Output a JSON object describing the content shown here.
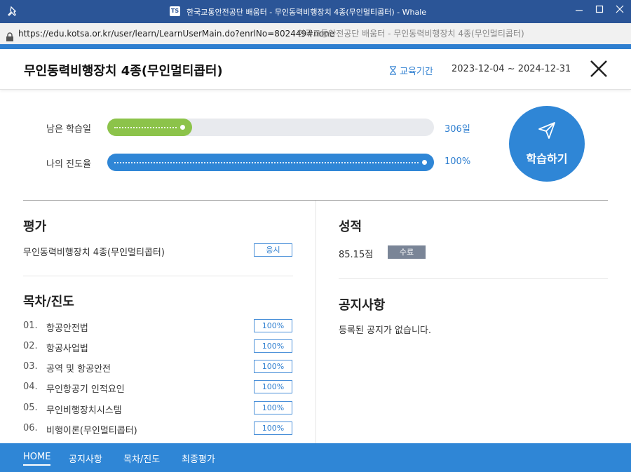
{
  "browser": {
    "window_title": "한국교통안전공단 배움터 - 무인동력비행장치 4종(무인멀티콥터) - Whale",
    "favicon_text": "TS",
    "url": "https://edu.kotsa.or.kr/user/learn/LearnUserMain.do?enrlNo=802449#none",
    "page_title": "한국교통안전공단 배움터 - 무인동력비행장치 4종(무인멀티콥터)"
  },
  "header": {
    "course_title": "무인동력비행장치 4종(무인멀티콥터)",
    "period_label": "교육기간",
    "period_dates": "2023-12-04 ~ 2024-12-31"
  },
  "progress": {
    "remaining": {
      "label": "남은 학습일",
      "value": "306일",
      "fraction": 0.26,
      "color": "#8cc34a"
    },
    "completion": {
      "label": "나의 진도율",
      "value": "100%",
      "fraction": 1.0,
      "color": "#2f86d6"
    }
  },
  "study_button": {
    "label": "학습하기"
  },
  "evaluation": {
    "title": "평가",
    "course_name": "무인동력비행장치 4종(무인멀티콥터)",
    "action_label": "응시"
  },
  "grade": {
    "title": "성적",
    "score": "85.15점",
    "status": "수료"
  },
  "toc": {
    "title": "목차/진도",
    "items": [
      {
        "num": "01.",
        "name": "항공안전법",
        "progress": "100%"
      },
      {
        "num": "02.",
        "name": "항공사업법",
        "progress": "100%"
      },
      {
        "num": "03.",
        "name": "공역 및 항공안전",
        "progress": "100%"
      },
      {
        "num": "04.",
        "name": "무인항공기 인적요인",
        "progress": "100%"
      },
      {
        "num": "05.",
        "name": "무인비행장치시스템",
        "progress": "100%"
      },
      {
        "num": "06.",
        "name": "비행이론(무인멀티콥터)",
        "progress": "100%"
      }
    ]
  },
  "notice": {
    "title": "공지사항",
    "empty_text": "등록된 공지가 없습니다."
  },
  "bottom_nav": {
    "items": [
      {
        "label": "HOME",
        "active": true
      },
      {
        "label": "공지사항",
        "active": false
      },
      {
        "label": "목차/진도",
        "active": false
      },
      {
        "label": "최종평가",
        "active": false
      }
    ]
  }
}
